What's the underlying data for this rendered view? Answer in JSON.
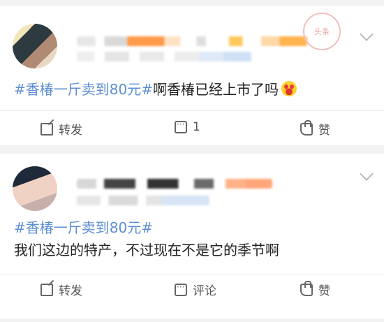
{
  "posts": [
    {
      "stamp_text": "头条",
      "topic": "#香椿一斤卖到80元#",
      "text": "啊香椿已经上市了吗",
      "actions": {
        "share_label": "转发",
        "comment_label": "1",
        "like_label": "赞"
      }
    },
    {
      "topic": "#香椿一斤卖到80元#",
      "text": "我们这边的特产，不过现在不是它的季节啊",
      "actions": {
        "share_label": "转发",
        "comment_label": "评论",
        "like_label": "赞"
      }
    }
  ],
  "icons": [
    "share-icon",
    "comment-icon",
    "like-icon",
    "chevron-down-icon"
  ],
  "colors": {
    "topic": "#5c8fd1",
    "background": "#f2f2f2"
  }
}
